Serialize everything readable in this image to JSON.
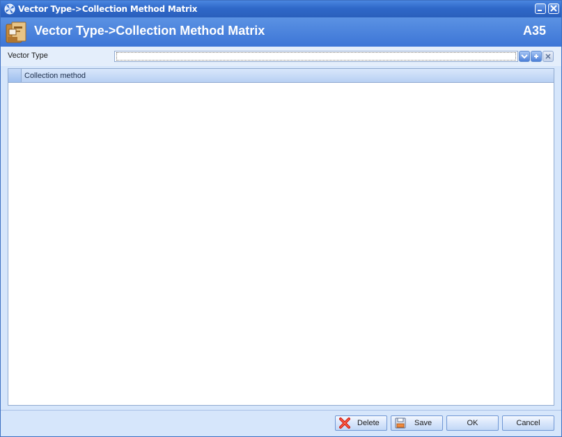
{
  "window": {
    "title": "Vector Type->Collection Method Matrix",
    "app_icon": "windmill-icon",
    "minimize_icon": "minimize-icon",
    "close_icon": "close-icon"
  },
  "header": {
    "title": "Vector Type->Collection Method Matrix",
    "code": "A35",
    "icon": "folder-documents-icon"
  },
  "form": {
    "vector_type_label": "Vector Type",
    "vector_type_value": "",
    "dropdown_icon": "chevron-down-icon",
    "add_icon": "plus-icon",
    "clear_icon": "x-icon"
  },
  "grid": {
    "columns": [
      "Collection method"
    ],
    "rows": []
  },
  "footer": {
    "delete_label": "Delete",
    "save_label": "Save",
    "ok_label": "OK",
    "cancel_label": "Cancel"
  },
  "colors": {
    "title_bar": "#2f68c8",
    "header_band": "#4a82dc",
    "window_bg": "#d6e6fb",
    "grid_header": "#c6daf8"
  }
}
